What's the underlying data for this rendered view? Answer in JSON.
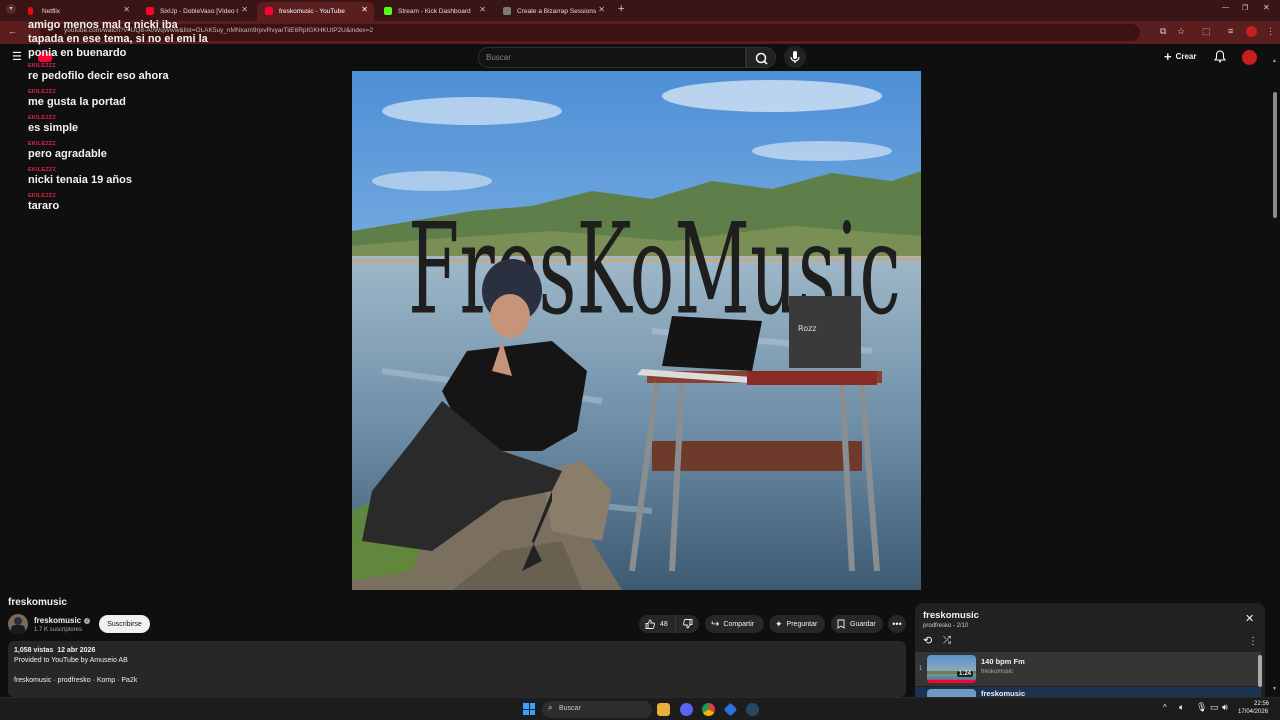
{
  "browser": {
    "tabs": [
      {
        "title": "Netflix",
        "color": "#e50914"
      },
      {
        "title": "SixUp - DobleVaso [Video Oficial]",
        "color": "#ff0033"
      },
      {
        "title": "freskomusic - YouTube",
        "color": "#ff0033"
      },
      {
        "title": "Stream - Kick Dashboard",
        "color": "#53fc18"
      },
      {
        "title": "Create a Bizarrap Sessions Tier",
        "color": "#6a6a6a"
      }
    ],
    "url": "youtube.com/watch?v=UQ8-A0WqWww&list=OLAK5uy_nMNxam9rjxvRvyarTiiE6RpIGKHKUtP2U&index=2"
  },
  "youtube": {
    "search_placeholder": "Buscar",
    "create_label": "Crear"
  },
  "chat": {
    "top_lines": [
      "amigo menos mal q nicki iba",
      "tapada en ese tema, si no el emi la",
      "ponia en buenardo"
    ],
    "messages": [
      {
        "user": "EKILEZZZ",
        "text": "re pedofilo decir eso ahora"
      },
      {
        "user": "EKILEZZZ",
        "text": "me gusta la portad"
      },
      {
        "user": "EKILEZZZ",
        "text": "es simple"
      },
      {
        "user": "EKILEZZZ",
        "text": "pero agradable"
      },
      {
        "user": "EKILEZZZ",
        "text": "nicki tenaia 19 años"
      },
      {
        "user": "EKILEZZZ",
        "text": "tararo"
      }
    ]
  },
  "video": {
    "cover_text": "FresKoMusic",
    "amp_label": "Rozz"
  },
  "info": {
    "title": "freskomusic",
    "channel": "freskomusic",
    "subscribers": "1.7 K suscriptores",
    "subscribe_label": "Suscribirse",
    "likes": "48",
    "share_label": "Compartir",
    "ask_label": "Preguntar",
    "save_label": "Guardar"
  },
  "description": {
    "stats": "1,058 vistas  12 abr 2026",
    "provided": "Provided to YouTube by Amuseio AB",
    "credits": "freskomusic · prodfresko · Komp · Pa2k"
  },
  "playlist": {
    "title": "freskomusic",
    "subtitle": "prodfresko - 2/10",
    "items": [
      {
        "index": "1",
        "title": "140 bpm Fm",
        "channel": "freskomusic",
        "duration": "1:24"
      },
      {
        "index": "",
        "title": "freskomusic",
        "channel": "",
        "duration": ""
      }
    ]
  },
  "taskbar": {
    "search_label": "Buscar",
    "time": "22:56",
    "date": "17/04/2026"
  }
}
